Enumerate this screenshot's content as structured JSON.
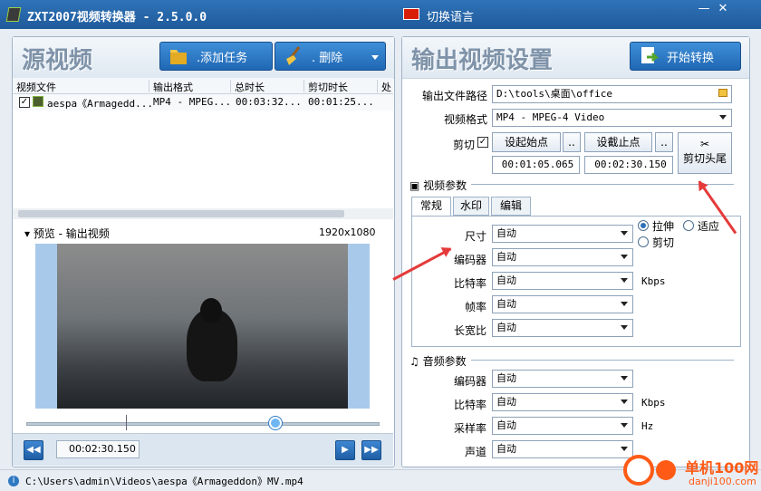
{
  "window": {
    "title": "ZXT2007视频转换器 - 2.5.0.0",
    "language_label": "切换语言",
    "minimize_label": "—",
    "close_label": "✕"
  },
  "left": {
    "title": "源视频",
    "add_task": ".添加任务",
    "delete": ". 删除",
    "columns": [
      "视频文件",
      "输出格式",
      "总时长",
      "剪切时长",
      "处"
    ],
    "row": {
      "file": "aespa《Armagedd...",
      "format": "MP4 - MPEG...",
      "duration": "00:03:32...",
      "cut_duration": "00:01:25..."
    },
    "preview_label": "预览 - 输出视频",
    "resolution": "1920x1080",
    "current_time": "00:02:30.150",
    "progress_percent": 68
  },
  "right": {
    "title": "输出视频设置",
    "start_convert": "开始转换",
    "output_path_label": "输出文件路径",
    "output_path": "D:\\tools\\桌面\\office",
    "format_label": "视频格式",
    "format_value": "MP4 - MPEG-4 Video",
    "cut_label": "剪切",
    "set_start": "设起始点",
    "set_end": "设截止点",
    "dots": "..",
    "start_time": "00:01:05.065",
    "end_time": "00:02:30.150",
    "cut_ends": "剪切头尾",
    "video_params": "视频参数",
    "tabs": [
      "常规",
      "水印",
      "编辑"
    ],
    "size_label": "尺寸",
    "encoder_label": "编码器",
    "bitrate_label": "比特率",
    "framerate_label": "帧率",
    "aspect_label": "长宽比",
    "auto": "自动",
    "stretch": "拉伸",
    "fit": "适应",
    "crop": "剪切",
    "kbps": "Kbps",
    "audio_params": "音频参数",
    "sample_rate_label": "采样率",
    "channel_label": "声道",
    "hz": "Hz"
  },
  "status": {
    "info": "i",
    "path": "C:\\Users\\admin\\Videos\\aespa《Armageddon》MV.mp4"
  },
  "watermark": {
    "site": "单机100网",
    "url": "danji100.com"
  },
  "colors": {
    "accent": "#1f67b4",
    "arrow": "#e53a3a",
    "watermark": "#ff5b16"
  }
}
